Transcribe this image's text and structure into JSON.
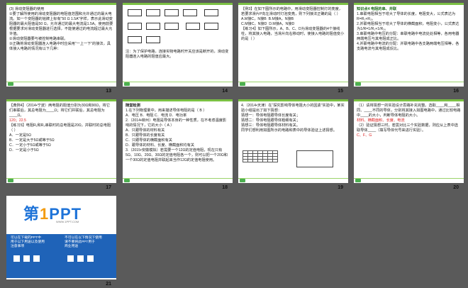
{
  "slides": [
    {
      "num": "13",
      "lines": [
        "(3) 滑动变阻器的使用",
        "①要了解所使用的滑动变阻器的电阻值范围和允许通过的最大电流。如一个变阻器的铭牌上标有“50 Ω 1.5A”字样，表示此滑动变阻器的最大阻值是50 Ω，允许通过的最大电流是1.5A。使用前要根据要求对滑动变阻器进行选择，不能使通过的电流超过最大允许值。",
        "②滑动变阻器要与被控制电路串联。",
        "③正确将滑动变阻器连入电路中时应采用“一上一下”的接法，具体接入电路的情况有以下几种："
      ]
    },
    {
      "num": "14",
      "caption": "注：为了保护电路，连接实物电路时开关应该是断开的，滑动变阻器连入电路的阻值应最大。"
    },
    {
      "num": "15",
      "lines": [
        "【例3】在如下图所示的电路中，用滑动变阻器控制灯的亮度，若要求滑片P向左滑动时灯泡变亮，则下列接法正确的是（  ）"
      ],
      "options": [
        "A.M接C，N接B",
        "B.M接A，N接B",
        "C.M接C，N接D",
        "D.M接A，N接D"
      ],
      "practice": "【练习4】如下图所示，A、B、C、D为滑动变阻器的4个接线柱，将其接入电路，当滑片向右移动时，使接入电路的阻值变小的是（  ）"
    },
    {
      "num": "16",
      "heading": "知识点4 电阻的串、并联",
      "lines": [
        "1.串联电阻相当于增大了导体的长度，电阻变大，公式表达为R=R₁+R₂。",
        "2.并联电阻相当于增大了导体的横截面积，电阻变小，公式表达为1/R=1/R₁+1/R₂。",
        "3.串联电路中电压的分配：串联电路中电流处处相等，各用电器两端电压与其电阻成正比。",
        "4.并联电路中电流的分配：并联电路中各支路两端电压相等，各支路电流与其电阻成反比。"
      ]
    },
    {
      "num": "17",
      "lines": [
        "【典例4】（2014•宁波）两电阻的阻值分别为30Ω和90Ω，将它们串联后，其总电阻为____Ω；将它们并联后，其总电阻为____Ω。",
        "【练习5】电阻R₁和R₂串联时的总电阻是20Ω，并联时的总电阻（  ）",
        "A．一定是5Ω",
        "B．一定是大于5Ω或等于5Ω",
        "C．一定小于5Ω或等于5Ω",
        "D．一定是小于5Ω"
      ],
      "answer": "120；22.5"
    },
    {
      "num": "18",
      "heading": "随堂检测",
      "lines": [
        "1.在下列物理量中，用来描述导体电阻的是（ B ）",
        "A．电压    B．电阻    C．电流    D．电功率",
        "2.（2014•柳州）电阻是导体本身的一种性质，在不考虑温度影响的情况下，它的大小（ A ）",
        "A．只跟导体的材料有关",
        "B．只跟导体的长度有关",
        "C．只跟导体的横截面积有关",
        "D．跟导体的材料、长度、横截面积均有关",
        "3.（2015•安徽模拟）若需要一个12Ω的定值电阻，现在只有5Ω、10Ω、20Ω、30Ω的定值电阻各一个，则可以把一个20Ω和一个30Ω的定值电阻并联起来当作12Ω的定值电阻使用。"
      ]
    },
    {
      "num": "19",
      "lines": [
        "4.（2014•天津）在“探究影响导体电阻大小的因素”实验中，某实验小组提出了如下猜想：",
        "猜想一：导体电阻跟导体长度有关；",
        "猜想二：导体电阻跟导体粗细有关；",
        "猜想三：导体电阻跟导体材料有关。",
        "同学们想利用如图所示的电路和表中的导体验证上述猜想。"
      ]
    },
    {
      "num": "20",
      "lines": [
        "（1）请将猜想一的实验设计思路补充完整。选取____和____相同、____不同的导体，分别将其接入如图电路中，通过比较电路中____的大小，判断导体电阻的大小。",
        "（2）验证猜想三时，若需对比三个实验数据，则应从上表中选取导体____（填写导体代号来进行实验）。"
      ],
      "answers": [
        "材料",
        "横截面积",
        "长度",
        "电流",
        "C、F、G"
      ]
    },
    {
      "num": "21",
      "brand_main": "第",
      "brand_num": "1",
      "brand_tail": "PPT",
      "brand_sub": "WWW.1PPT.COM",
      "band_left": [
        "可以在下载的PPT中",
        "用于以下用途以及使用",
        "注意事项"
      ],
      "band_right": [
        "不可以在以下情况下使用",
        "请不要将此PPT用于",
        "商业用途"
      ]
    }
  ],
  "colors": {
    "accent_green": "#7bc043",
    "answer_red": "#d22222",
    "brand_blue": "#1e73d8",
    "brand_orange": "#f39c12",
    "background": "#5a5a5a"
  }
}
